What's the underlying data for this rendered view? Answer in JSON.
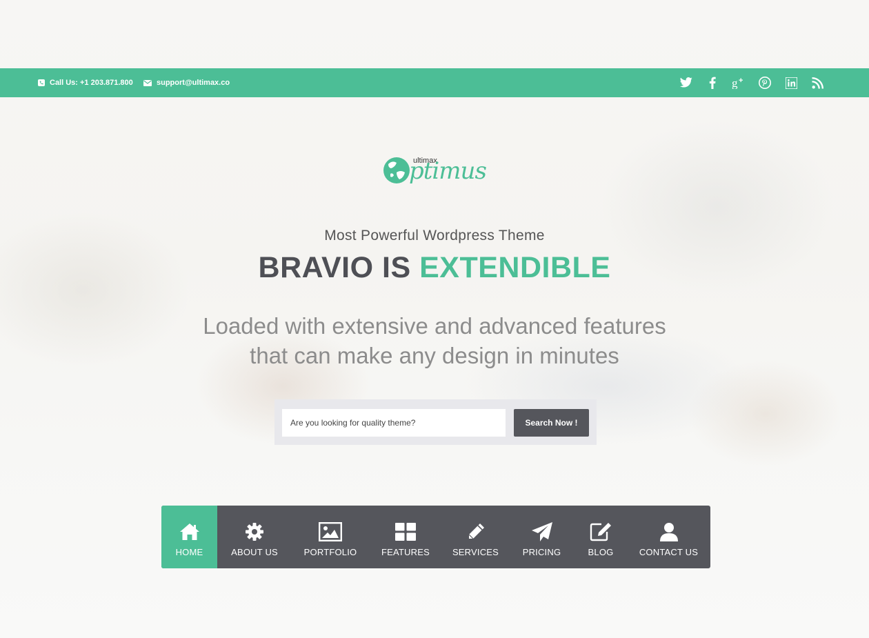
{
  "topbar": {
    "phone_label": "Call Us: +1 203.871.800",
    "email_label": "support@ultimax.co",
    "social": [
      "twitter-icon",
      "facebook-icon",
      "google-plus-icon",
      "pinterest-icon",
      "linkedin-icon",
      "rss-icon"
    ]
  },
  "logo": {
    "brand": "ptimus",
    "super": "ultimax"
  },
  "hero": {
    "tagline": "Most Powerful Wordpress Theme",
    "headline_part1": "BRAVIO IS ",
    "headline_accent": "EXTENDIBLE",
    "sub_line1": "Loaded with extensive and advanced features",
    "sub_line2": "that can make any design in minutes"
  },
  "search": {
    "placeholder": "Are you looking for quality theme?",
    "button_label": "Search Now !"
  },
  "nav": {
    "items": [
      {
        "label": "HOME",
        "icon": "home-icon",
        "active": true
      },
      {
        "label": "ABOUT US",
        "icon": "gear-icon"
      },
      {
        "label": "PORTFOLIO",
        "icon": "image-icon"
      },
      {
        "label": "FEATURES",
        "icon": "grid-icon"
      },
      {
        "label": "SERVICES",
        "icon": "pencil-icon"
      },
      {
        "label": "PRICING",
        "icon": "paper-plane-icon"
      },
      {
        "label": "BLOG",
        "icon": "edit-icon"
      },
      {
        "label": "CONTACT US",
        "icon": "user-icon"
      }
    ]
  },
  "colors": {
    "accent": "#4cbe96",
    "nav_bg": "#55565c",
    "headline": "#4e4f55"
  }
}
